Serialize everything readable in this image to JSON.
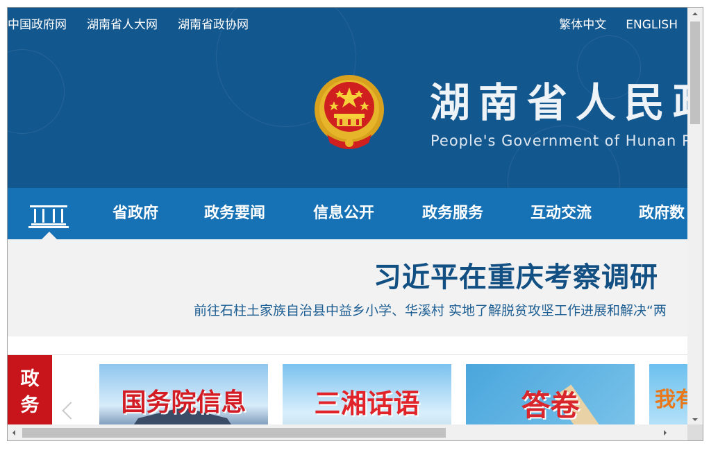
{
  "top_links": [
    "中国政府网",
    "湖南省人大网",
    "湖南省政协网"
  ],
  "lang_links": [
    "繁体中文",
    "ENGLISH"
  ],
  "site": {
    "title_cn": "湖南省人民政",
    "title_en": "People's Government of Hunan P"
  },
  "nav": {
    "home_icon": "government-building-icon",
    "items": [
      "省政府",
      "政务要闻",
      "信息公开",
      "政务服务",
      "互动交流",
      "政府数"
    ]
  },
  "headline": {
    "title": "习近平在重庆考察调研",
    "subtitle": "前往石柱土家族自治县中益乡小学、华溪村 实地了解脱贫攻坚工作进展和解决“两"
  },
  "section_tab": {
    "lines": [
      "政",
      "务"
    ]
  },
  "tiles": [
    {
      "label": "国务院信息",
      "color": "#d41c24"
    },
    {
      "label": "三湘话语",
      "color": "#e0242a"
    },
    {
      "label": "答卷",
      "color": "#d8262c"
    },
    {
      "label": "我有",
      "color": "#e8781a"
    }
  ],
  "colors": {
    "header_bg": "#13578f",
    "nav_bg": "#1672b4",
    "headline_text": "#124f82",
    "red_tab": "#c8141b"
  }
}
